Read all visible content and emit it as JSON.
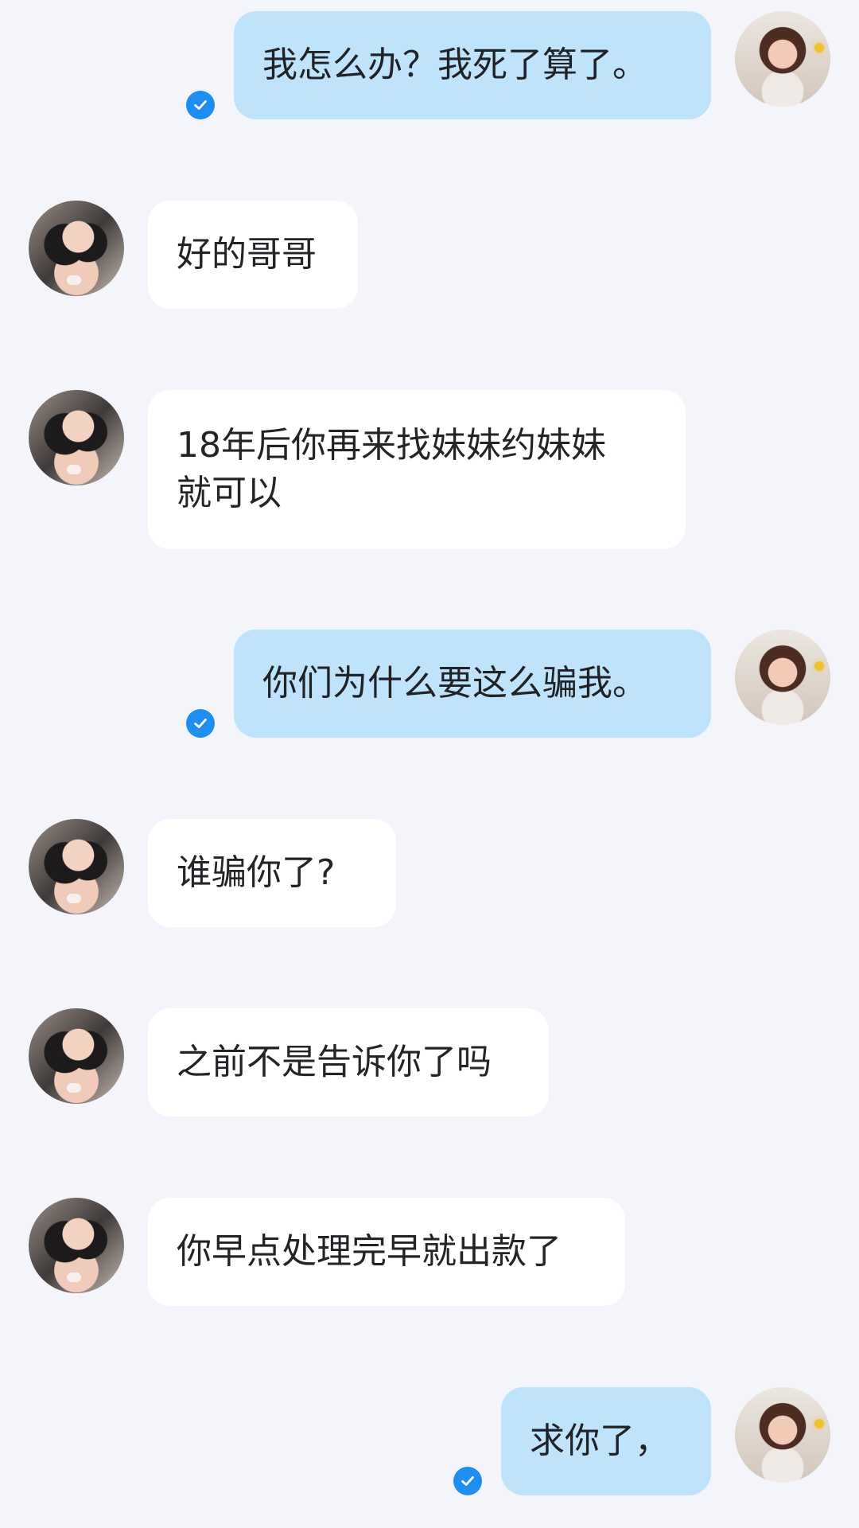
{
  "chat": {
    "messages": [
      {
        "from": "me",
        "text": "我怎么办？我死了算了。"
      },
      {
        "from": "other",
        "text": "好的哥哥"
      },
      {
        "from": "other",
        "text": "18年后你再来找妹妹约妹妹\n就可以"
      },
      {
        "from": "me",
        "text": "你们为什么要这么骗我。"
      },
      {
        "from": "other",
        "text": "谁骗你了?"
      },
      {
        "from": "other",
        "text": "之前不是告诉你了吗"
      },
      {
        "from": "other",
        "text": "你早点处理完早就出款了"
      },
      {
        "from": "me",
        "text": "求你了，"
      }
    ]
  },
  "icons": {
    "read_receipt": "check-circle-icon"
  },
  "colors": {
    "background": "#f4f5fa",
    "other_bubble": "#ffffff",
    "my_bubble": "#bfe3fa",
    "read_receipt": "#1f8ef1"
  }
}
